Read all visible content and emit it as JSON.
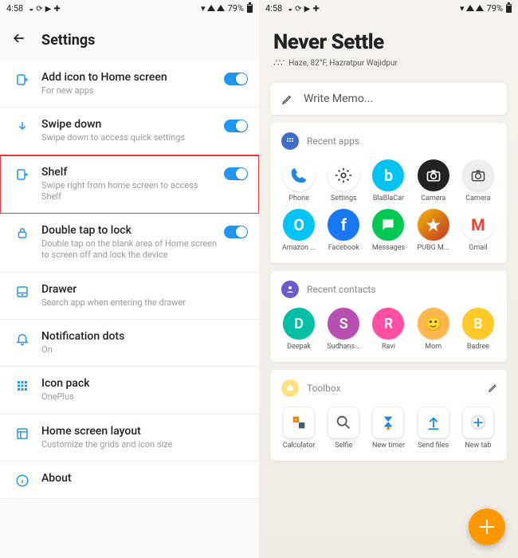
{
  "status": {
    "time": "4:58",
    "battery": "79%"
  },
  "settings": {
    "title": "Settings",
    "items": [
      {
        "icon": "add-home",
        "title": "Add icon to Home screen",
        "sub": "For new apps",
        "toggle": true
      },
      {
        "icon": "swipe-down",
        "title": "Swipe down",
        "sub": "Swipe down to access quick settings",
        "toggle": true
      },
      {
        "icon": "shelf",
        "title": "Shelf",
        "sub": "Swipe right from home screen to access Shelf",
        "toggle": true,
        "highlight": true
      },
      {
        "icon": "lock",
        "title": "Double tap to lock",
        "sub": "Double tap on the blank area of Home screen to screen off and lock the device",
        "toggle": true
      },
      {
        "icon": "drawer",
        "title": "Drawer",
        "sub": "Search app when entering the drawer"
      },
      {
        "icon": "bell",
        "title": "Notification dots",
        "sub": "On"
      },
      {
        "icon": "grid",
        "title": "Icon pack",
        "sub": "OnePlus"
      },
      {
        "icon": "layout",
        "title": "Home screen layout",
        "sub": "Customize the grids and icon size"
      },
      {
        "icon": "info",
        "title": "About",
        "sub": ""
      }
    ]
  },
  "shelf": {
    "title": "Never Settle",
    "weather": "Haze, 82°F, Hazratpur Wajidpur",
    "memo": "Write Memo...",
    "recent_apps_label": "Recent apps",
    "recent_apps": [
      {
        "label": "Phone",
        "bg": "#fff",
        "fg": "#1e88e5",
        "glyph": "phone"
      },
      {
        "label": "Settings",
        "bg": "#fff",
        "fg": "#444",
        "glyph": "gear"
      },
      {
        "label": "BlaBlaCar",
        "bg": "#00c2f0",
        "fg": "#fff",
        "glyph": "b"
      },
      {
        "label": "Camera",
        "bg": "#222",
        "fg": "#fff",
        "glyph": "cam"
      },
      {
        "label": "Camera",
        "bg": "#eee",
        "fg": "#555",
        "glyph": "cam"
      },
      {
        "label": "Amazon ...",
        "bg": "#00c4f5",
        "fg": "#fff",
        "glyph": "O"
      },
      {
        "label": "Facebook",
        "bg": "#1877f2",
        "fg": "#fff",
        "glyph": "f"
      },
      {
        "label": "Messages",
        "bg": "#00c853",
        "fg": "#fff",
        "glyph": "msg"
      },
      {
        "label": "PUBG M...",
        "bg": "linear-gradient(135deg,#f4b400,#c0392b)",
        "fg": "#fff",
        "glyph": "★"
      },
      {
        "label": "Gmail",
        "bg": "#fff",
        "fg": "#ea4335",
        "glyph": "M"
      }
    ],
    "recent_contacts_label": "Recent contacts",
    "recent_contacts": [
      {
        "label": "Deepak",
        "bg": "#00bfa5",
        "initial": "D"
      },
      {
        "label": "Sudhans...",
        "bg": "#b84fb3",
        "initial": "S"
      },
      {
        "label": "Ravi",
        "bg": "#ff4fa3",
        "initial": "R"
      },
      {
        "label": "Mom",
        "bg": "#ffb74d",
        "initial": ""
      },
      {
        "label": "Badree",
        "bg": "#ffca28",
        "initial": "B"
      }
    ],
    "toolbox_label": "Toolbox",
    "toolbox": [
      {
        "label": "Calculator"
      },
      {
        "label": "Selfie"
      },
      {
        "label": "New timer"
      },
      {
        "label": "Send files"
      },
      {
        "label": "New tab"
      }
    ]
  }
}
